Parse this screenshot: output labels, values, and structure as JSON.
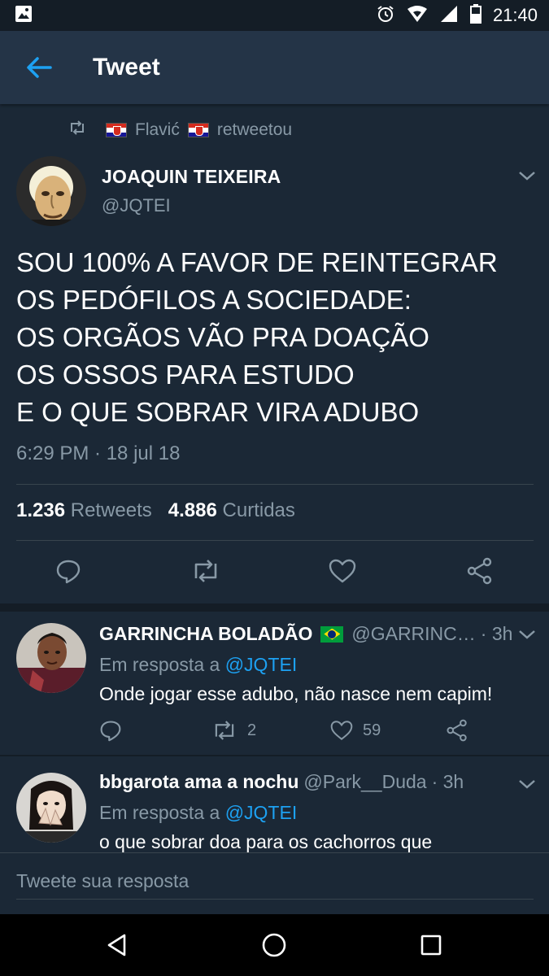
{
  "status_bar": {
    "time": "21:40"
  },
  "app_bar": {
    "title": "Tweet"
  },
  "retweet_context": {
    "user": "Flavić",
    "suffix": "retweetou"
  },
  "tweet": {
    "author_name": "JOAQUIN TEIXEIRA",
    "author_handle": "@JQTEI",
    "text_lines": [
      "SOU 100% A FAVOR DE REINTEGRAR",
      "OS PEDÓFILOS A SOCIEDADE:",
      "OS ORGÃOS VÃO PRA DOAÇÃO",
      "OS OSSOS PARA ESTUDO",
      "E O QUE SOBRAR VIRA ADUBO"
    ],
    "timestamp": "6:29 PM · 18 jul 18",
    "retweets_count": "1.236",
    "retweets_label": "Retweets",
    "likes_count": "4.886",
    "likes_label": "Curtidas"
  },
  "replies": [
    {
      "name": "GARRINCHA BOLADÃO",
      "handle": "@GARRINC…",
      "time": "· 3h",
      "in_reply_prefix": "Em resposta a",
      "in_reply_mention": "@JQTEI",
      "text": "Onde jogar esse adubo, não nasce nem capim!",
      "retweets": "2",
      "likes": "59"
    },
    {
      "name": "bbgarota ama a nochu",
      "handle": "@Park__Duda",
      "time": "· 3h",
      "in_reply_prefix": "Em resposta a",
      "in_reply_mention": "@JQTEI",
      "text": "o que sobrar doa para os cachorros que"
    }
  ],
  "compose": {
    "placeholder": "Tweete sua resposta"
  },
  "colors": {
    "background": "#1b2836",
    "app_bar": "#243447",
    "accent": "#1da1f2",
    "muted": "#8899a6"
  }
}
